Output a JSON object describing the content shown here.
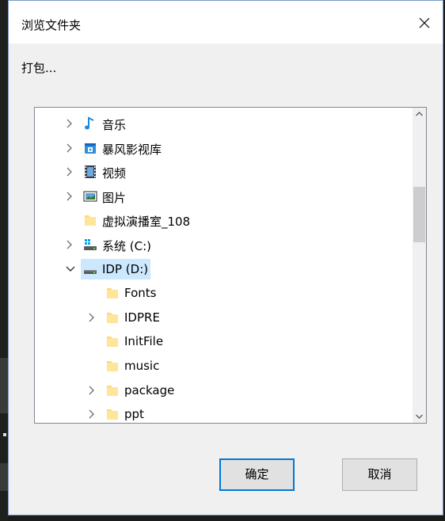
{
  "dialog": {
    "title": "浏览文件夹",
    "description": "打包...",
    "ok_label": "确定",
    "cancel_label": "取消"
  },
  "tree": {
    "items": [
      {
        "label": "音乐",
        "icon": "music-note-icon",
        "expander": "collapsed"
      },
      {
        "label": "暴风影视库",
        "icon": "media-library-icon",
        "expander": "collapsed"
      },
      {
        "label": "视频",
        "icon": "video-icon",
        "expander": "collapsed"
      },
      {
        "label": "图片",
        "icon": "pictures-icon",
        "expander": "collapsed"
      },
      {
        "label": "虚拟演播室_108",
        "icon": "folder-icon",
        "expander": "none"
      },
      {
        "label": "系统 (C:)",
        "icon": "system-drive-icon",
        "expander": "collapsed"
      },
      {
        "label": "IDP (D:)",
        "icon": "drive-icon",
        "expander": "expanded",
        "selected": true
      },
      {
        "label": "Fonts",
        "icon": "folder-icon",
        "expander": "none"
      },
      {
        "label": "IDPRE",
        "icon": "folder-icon",
        "expander": "collapsed"
      },
      {
        "label": "InitFile",
        "icon": "folder-icon",
        "expander": "none"
      },
      {
        "label": "music",
        "icon": "folder-icon",
        "expander": "none"
      },
      {
        "label": "package",
        "icon": "folder-icon",
        "expander": "collapsed"
      },
      {
        "label": "ppt",
        "icon": "folder-icon",
        "expander": "collapsed"
      }
    ]
  },
  "colors": {
    "selection": "#cce8ff",
    "folder": "#ffd86e",
    "accent": "#0078d7"
  }
}
